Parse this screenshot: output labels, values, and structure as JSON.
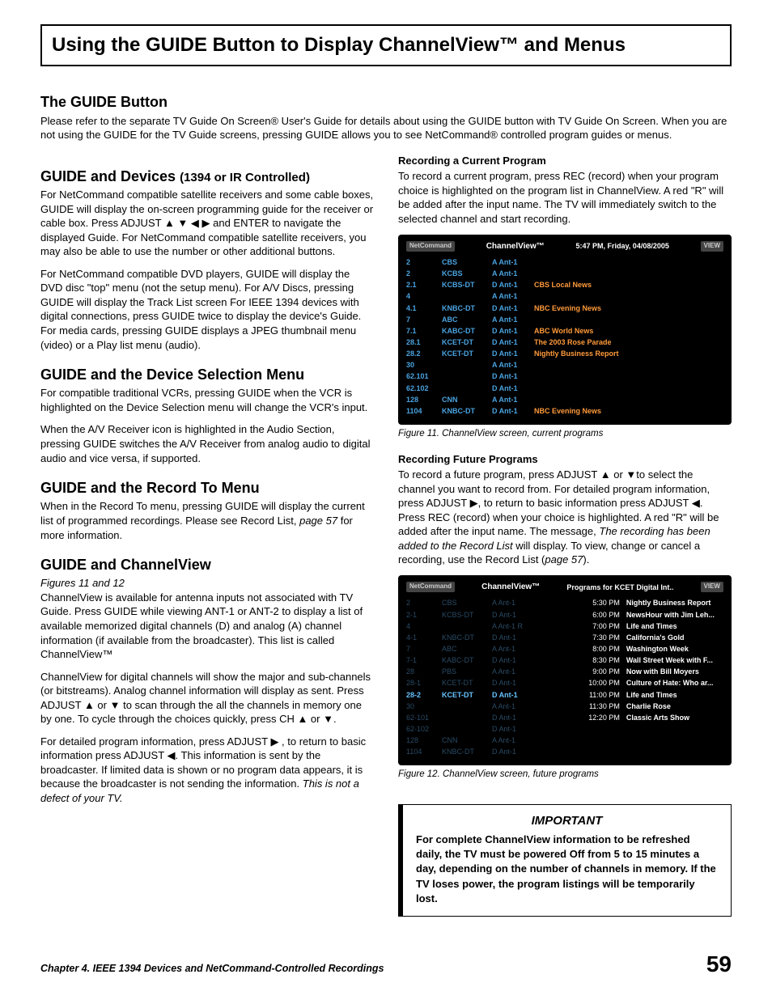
{
  "page_title": "Using the GUIDE Button to Display ChannelView™ and Menus",
  "intro": {
    "heading": "The GUIDE Button",
    "body": "Please refer to the separate TV Guide On Screen® User's Guide for details about using the GUIDE button with TV Guide On Screen.  When you are not using the GUIDE for the TV Guide screens, pressing GUIDE allows you to see NetCommand® controlled program guides or menus."
  },
  "left": {
    "s1_heading": "GUIDE and Devices",
    "s1_sub": "(1394 or IR Controlled)",
    "s1_p1a": "For NetCommand compatible satellite receivers and some cable boxes, GUIDE will display the on-screen programming guide for the receiver or cable box.  Press ADJUST ",
    "s1_p1b": " and ENTER to navigate the displayed Guide.  For NetCommand compatible satellite receivers, you may also be able to use the number or other additional buttons.",
    "s1_p2": "For NetCommand compatible DVD players, GUIDE will display the DVD disc \"top\" menu (not the setup menu).  For A/V Discs, pressing GUIDE will display the Track List screen For IEEE 1394 devices with digital connections, press GUIDE twice to display the device's Guide.  For media cards, pressing GUIDE displays a JPEG thumbnail menu (video) or a Play list menu (audio).",
    "s2_heading": "GUIDE and the Device Selection Menu",
    "s2_p1": "For compatible traditional VCRs, pressing GUIDE when the VCR is highlighted on the Device Selection menu will change the VCR's input.",
    "s2_p2": "When the A/V Receiver icon is highlighted in the Audio Section, pressing GUIDE switches the A/V Receiver from analog audio to digital audio and vice versa, if supported.",
    "s3_heading": "GUIDE and the Record To Menu",
    "s3_p1a": "When in the Record To menu, pressing GUIDE will display the current list of programmed recordings.  Please see Record List, ",
    "s3_p1b": "page 57",
    "s3_p1c": " for more information.",
    "s4_heading": "GUIDE and ChannelView",
    "s4_ref": "Figures 11 and 12",
    "s4_p1": "ChannelView is available for antenna inputs not associated with TV Guide.  Press GUIDE while viewing ANT-1 or ANT-2 to display a list of available memorized digital channels (D) and analog (A) channel information (if available from the broadcaster).  This list is called ChannelView™",
    "s4_p2a": "ChannelView for digital channels will show the major and sub-channels (or bitstreams).  Analog channel information will display as sent.  Press ADJUST ",
    "s4_p2b": " to scan through the all the channels in memory one by one.  To cycle through the choices quickly, press CH ",
    "s4_p2c": ".",
    "s4_p3a": "For detailed program information, press ADJUST ",
    "s4_p3b": " , to return to basic information press ADJUST ",
    "s4_p3c": ".  This information is sent by the broadcaster.  If limited data is shown or no program data appears, it is because the broadcaster is not sending the information.  ",
    "s4_p3d": "This is not a defect of your TV."
  },
  "right": {
    "r1_heading": "Recording a Current Program",
    "r1_p1": "To record a current program, press REC (record) when your program choice is highlighted on the program list in ChannelView.  A red \"R\" will be added after the input name.  The TV will immediately switch to the selected channel and start recording.",
    "fig11_caption": "Figure 11. ChannelView screen, current programs",
    "r2_heading": "Recording Future Programs",
    "r2_p1a": "To record a future program, press ADJUST  ",
    "r2_p1b": "to select the channel you want to record from.  For detailed program information, press ADJUST  ",
    "r2_p1c": ", to return to basic information press ADJUST ",
    "r2_p1d": ".  Press REC (record) when your choice is highlighted.  A red \"R\" will be added after the input name.  The message, ",
    "r2_p1e": "The recording has been added to the Record List",
    "r2_p1f": " will display.  To view, change or cancel a recording, use the Record List (",
    "r2_p1g": "page 57",
    "r2_p1h": ").",
    "fig12_caption": "Figure 12. ChannelView screen, future programs",
    "important_title": "IMPORTANT",
    "important_body": "For complete ChannelView information to be refreshed daily, the TV must be powered Off from 5 to 15 minutes a day, depending on the number of channels in memory.  If the TV loses power, the program listings will be temporarily  lost."
  },
  "arrows": {
    "up": "▲",
    "down": "▼",
    "left": "◀",
    "right": "▶",
    "updown": "▲ or ▼",
    "all4": "▲ ▼ ◀ ▶"
  },
  "fig11": {
    "nc": "NetCommand",
    "title": "ChannelView™",
    "timestamp": "5:47 PM, Friday, 04/08/2005",
    "view": "VIEW",
    "rows": [
      {
        "c1": "2",
        "c2": "CBS",
        "c3": "A  Ant-1",
        "c4": ""
      },
      {
        "c1": "2",
        "c2": "KCBS",
        "c3": "A  Ant-1",
        "c4": ""
      },
      {
        "c1": "2.1",
        "c2": "KCBS-DT",
        "c3": "D  Ant-1",
        "c4": "CBS Local News"
      },
      {
        "c1": "4",
        "c2": "",
        "c3": "A  Ant-1",
        "c4": ""
      },
      {
        "c1": "4.1",
        "c2": "KNBC-DT",
        "c3": "D  Ant-1",
        "c4": "NBC Evening News"
      },
      {
        "c1": "7",
        "c2": "ABC",
        "c3": "A  Ant-1",
        "c4": ""
      },
      {
        "c1": "7.1",
        "c2": "KABC-DT",
        "c3": "D  Ant-1",
        "c4": "ABC World News"
      },
      {
        "c1": "28.1",
        "c2": "KCET-DT",
        "c3": "D  Ant-1",
        "c4": "The 2003 Rose Parade"
      },
      {
        "c1": "28.2",
        "c2": "KCET-DT",
        "c3": "D  Ant-1",
        "c4": "Nightly Business Report"
      },
      {
        "c1": "30",
        "c2": "",
        "c3": "A  Ant-1",
        "c4": ""
      },
      {
        "c1": "62.101",
        "c2": "",
        "c3": "D  Ant-1",
        "c4": ""
      },
      {
        "c1": "62.102",
        "c2": "",
        "c3": "D  Ant-1",
        "c4": ""
      },
      {
        "c1": "128",
        "c2": "CNN",
        "c3": "A  Ant-1",
        "c4": ""
      },
      {
        "c1": "1104",
        "c2": "KNBC-DT",
        "c3": "D  Ant-1",
        "c4": "NBC Evening News"
      }
    ]
  },
  "fig12": {
    "nc": "NetCommand",
    "title": "ChannelView™",
    "right_title": "Programs for KCET Digital Int..",
    "view": "VIEW",
    "left_rows": [
      {
        "c1": "2",
        "c2": "CBS",
        "c3": "A  Ant-1",
        "dim": true
      },
      {
        "c1": "2-1",
        "c2": "KCBS-DT",
        "c3": "D  Ant-1",
        "dim": true
      },
      {
        "c1": "4",
        "c2": "",
        "c3": "A  Ant-1 R",
        "dim": true
      },
      {
        "c1": "4-1",
        "c2": "KNBC-DT",
        "c3": "D  Ant-1",
        "dim": true
      },
      {
        "c1": "7",
        "c2": "ABC",
        "c3": "A  Ant-1",
        "dim": true
      },
      {
        "c1": "7-1",
        "c2": "KABC-DT",
        "c3": "D  Ant-1",
        "dim": true
      },
      {
        "c1": "28",
        "c2": "PBS",
        "c3": "A  Ant-1",
        "dim": true
      },
      {
        "c1": "28-1",
        "c2": "KCET-DT",
        "c3": "D  Ant-1",
        "dim": true
      },
      {
        "c1": "28-2",
        "c2": "KCET-DT",
        "c3": "D  Ant-1",
        "dim": false
      },
      {
        "c1": "30",
        "c2": "",
        "c3": "A  Ant-1",
        "dim": true
      },
      {
        "c1": "62-101",
        "c2": "",
        "c3": "D  Ant-1",
        "dim": true
      },
      {
        "c1": "62-102",
        "c2": "",
        "c3": "D  Ant-1",
        "dim": true
      },
      {
        "c1": "128",
        "c2": "CNN",
        "c3": "A  Ant-1",
        "dim": true
      },
      {
        "c1": "1104",
        "c2": "KNBC-DT",
        "c3": "D  Ant-1",
        "dim": true
      }
    ],
    "programs": [
      {
        "t": "5:30 PM",
        "n": "Nightly Business Report"
      },
      {
        "t": "6:00 PM",
        "n": "NewsHour with Jim Leh..."
      },
      {
        "t": "7:00 PM",
        "n": "Life and Times"
      },
      {
        "t": "7:30 PM",
        "n": "California's Gold"
      },
      {
        "t": "8:00 PM",
        "n": "Washington Week"
      },
      {
        "t": "8:30 PM",
        "n": "Wall Street Week with F..."
      },
      {
        "t": "9:00 PM",
        "n": "Now with Bill Moyers"
      },
      {
        "t": "10:00 PM",
        "n": "Culture of Hate: Who ar..."
      },
      {
        "t": "11:00 PM",
        "n": "Life and Times"
      },
      {
        "t": "11:30 PM",
        "n": "Charlie Rose"
      },
      {
        "t": "12:20 PM",
        "n": "Classic Arts Show"
      }
    ]
  },
  "footer": {
    "chapter": "Chapter 4. IEEE 1394 Devices and NetCommand-Controlled Recordings",
    "page": "59"
  }
}
